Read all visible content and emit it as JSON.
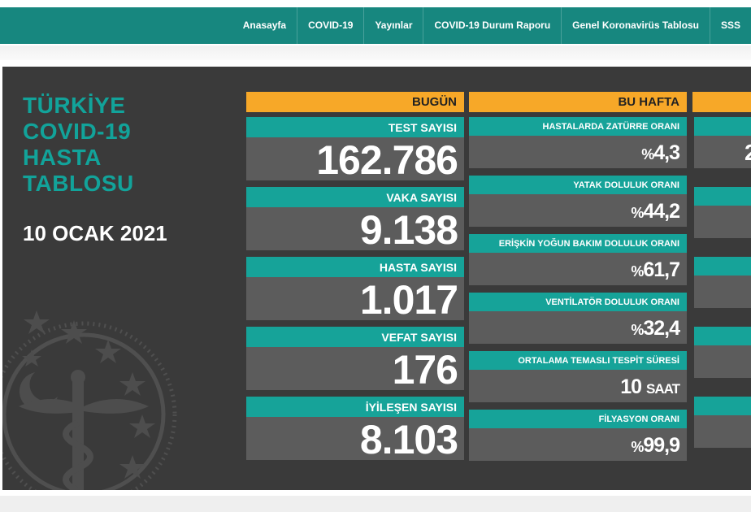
{
  "nav": {
    "items": [
      "Anasayfa",
      "COVID-19",
      "Yayınlar",
      "COVID-19 Durum Raporu",
      "Genel Koronavirüs Tablosu",
      "SSS"
    ]
  },
  "sidebar": {
    "title_lines": [
      "TÜRKİYE",
      "COVID-19",
      "HASTA",
      "TABLOSU"
    ],
    "date": "10 OCAK 2021"
  },
  "today": {
    "header": "BUGÜN",
    "stats": [
      {
        "label": "TEST SAYISI",
        "value": "162.786"
      },
      {
        "label": "VAKA SAYISI",
        "value": "9.138"
      },
      {
        "label": "HASTA SAYISI",
        "value": "1.017"
      },
      {
        "label": "VEFAT SAYISI",
        "value": "176"
      },
      {
        "label": "İYİLEŞEN SAYISI",
        "value": "8.103"
      }
    ]
  },
  "week": {
    "header": "BU HAFTA",
    "stats": [
      {
        "label": "HASTALARDA ZATÜRRE ORANI",
        "prefix": "%",
        "value": "4,3",
        "unit": ""
      },
      {
        "label": "YATAK DOLULUK ORANI",
        "prefix": "%",
        "value": "44,2",
        "unit": ""
      },
      {
        "label": "ERİŞKİN YOĞUN BAKIM DOLULUK ORANI",
        "prefix": "%",
        "value": "61,7",
        "unit": ""
      },
      {
        "label": "VENTİLATÖR DOLULUK ORANI",
        "prefix": "%",
        "value": "32,4",
        "unit": ""
      },
      {
        "label": "ORTALAMA TEMASLI TESPİT SÜRESİ",
        "prefix": "",
        "value": "10",
        "unit": "SAAT"
      },
      {
        "label": "FİLYASYON ORANI",
        "prefix": "%",
        "value": "99,9",
        "unit": ""
      }
    ]
  },
  "third_column": {
    "partial_value": "2"
  },
  "colors": {
    "nav_bg": "#17877f",
    "teal": "#16a399",
    "orange": "#f7a828",
    "panel_bg": "#3a3a3a",
    "value_bg": "#5c5c5c"
  }
}
